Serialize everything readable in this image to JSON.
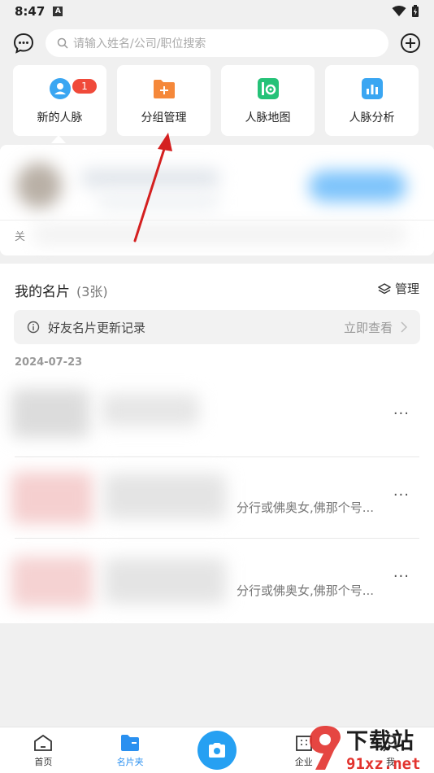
{
  "status_bar": {
    "time": "8:47",
    "notification_badge": "A"
  },
  "search": {
    "placeholder": "请输入姓名/公司/职位搜索"
  },
  "tiles": [
    {
      "label": "新的人脉",
      "icon": "person-icon",
      "badge": "1",
      "color": "#3aa6f2"
    },
    {
      "label": "分组管理",
      "icon": "folder-plus-icon",
      "color": "#f5883a"
    },
    {
      "label": "人脉地图",
      "icon": "map-icon",
      "color": "#25c278"
    },
    {
      "label": "人脉分析",
      "icon": "bar-chart-icon",
      "color": "#3aa6f2"
    }
  ],
  "new_panel": {
    "truncated_text": "关"
  },
  "my_cards": {
    "title": "我的名片",
    "count": "(3张)",
    "manage_label": "管理",
    "update_record": {
      "text": "好友名片更新记录",
      "action": "立即查看"
    },
    "date": "2024-07-23",
    "rows": [
      {
        "snippet": ""
      },
      {
        "snippet": "分行或佛奥女,佛那个号..."
      },
      {
        "snippet": "分行或佛奥女,佛那个号..."
      }
    ],
    "more_label": "···"
  },
  "bottom_nav": {
    "items": [
      {
        "label": "首页",
        "icon": "home-icon"
      },
      {
        "label": "名片夹",
        "icon": "card-folder-icon"
      },
      {
        "label": "",
        "icon": "camera-icon"
      },
      {
        "label": "企业",
        "icon": "building-icon"
      },
      {
        "label": "我",
        "icon": "profile-icon"
      }
    ],
    "active_color": "#2a90f0"
  },
  "watermark": {
    "main": "下载站",
    "sub": "91xz.net"
  },
  "annotation_color": "#d42020"
}
